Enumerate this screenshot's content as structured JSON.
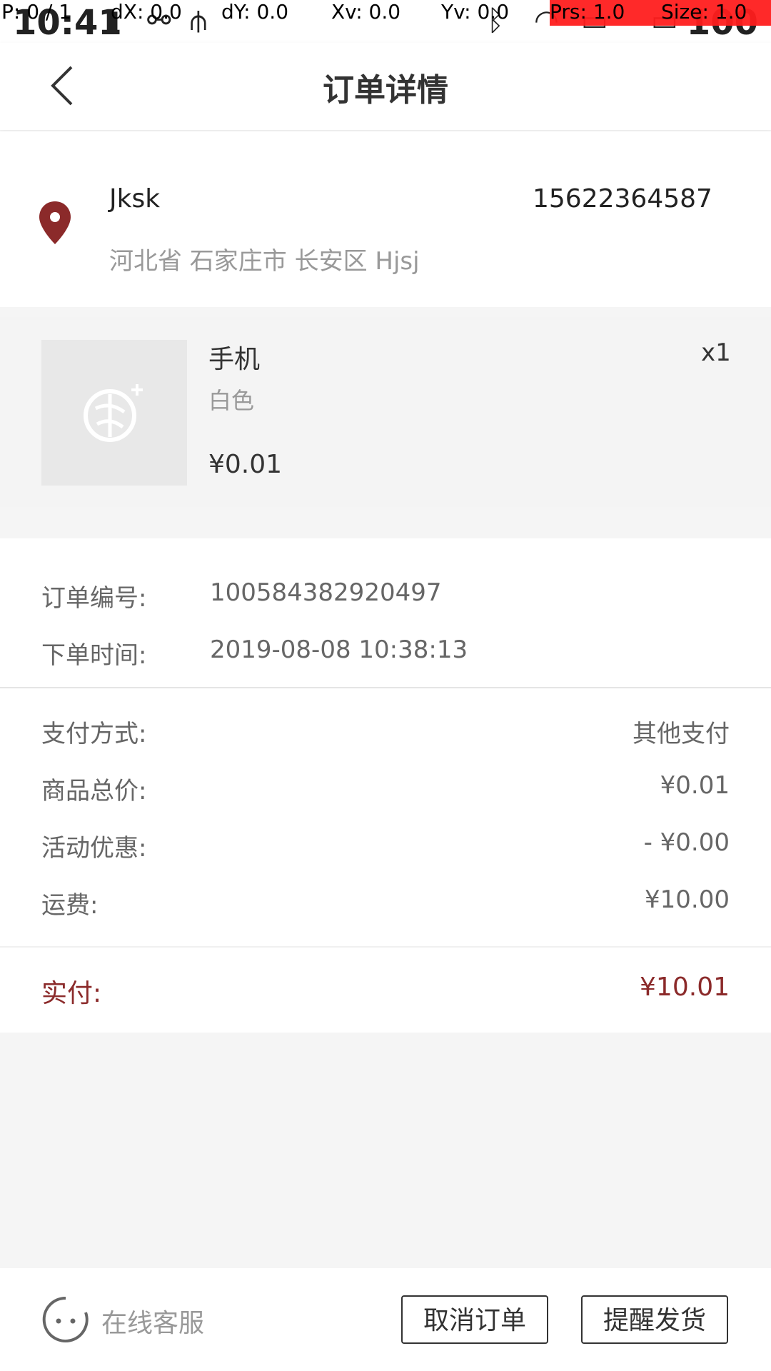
{
  "status_bar": {
    "time": "10:41",
    "battery": "100",
    "debug": {
      "p": "P: 0 / 1",
      "dx": "dX: 0.0",
      "dy": "dY: 0.0",
      "xv": "Xv: 0.0",
      "yv": "Yv: 0.0",
      "prs": "Prs: 1.0",
      "size": "Size: 1.0"
    }
  },
  "header": {
    "title": "订单详情",
    "back_icon": "chevron-left-icon"
  },
  "address": {
    "name": "Jksk",
    "phone": "15622364587",
    "detail": "河北省 石家庄市 长安区 Hjsj",
    "icon": "location-pin-icon",
    "icon_color": "#8b2a2a"
  },
  "product": {
    "name": "手机",
    "quantity": "x1",
    "spec": "白色",
    "price": "¥0.01"
  },
  "order_info": {
    "order_no_label": "订单编号:",
    "order_no": "100584382920497",
    "order_time_label": "下单时间:",
    "order_time": "2019-08-08 10:38:13"
  },
  "payment": {
    "method_label": "支付方式:",
    "method": "其他支付",
    "goods_total_label": "商品总价:",
    "goods_total": "¥0.01",
    "discount_label": "活动优惠:",
    "discount": "- ¥0.00",
    "shipping_label": "运费:",
    "shipping": "¥10.00",
    "paid_label": "实付:",
    "paid": "¥10.01",
    "accent_color": "#8b2a2a"
  },
  "bottom_bar": {
    "service_label": "在线客服",
    "service_icon": "chat-face-icon",
    "cancel_label": "取消订单",
    "remind_label": "提醒发货"
  }
}
